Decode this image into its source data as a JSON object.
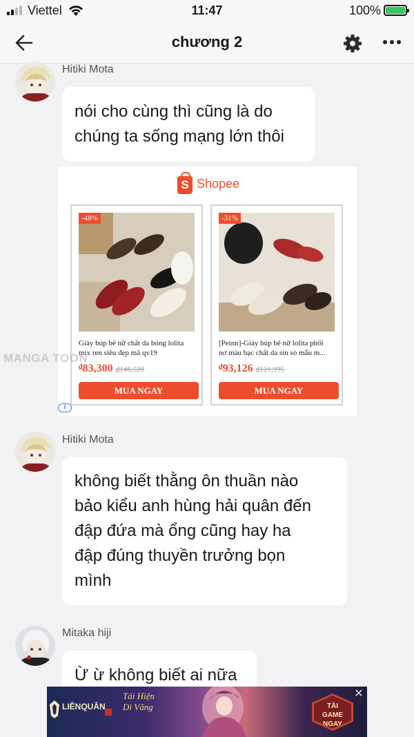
{
  "status_bar": {
    "carrier": "Viettel",
    "time": "11:47",
    "battery": "100%",
    "signal_bars_active": 2,
    "icons": [
      "signal-icon",
      "wifi-icon",
      "battery-charging-icon"
    ]
  },
  "nav": {
    "title": "chương 2",
    "icons": [
      "back-arrow-icon",
      "gear-icon",
      "more-icon"
    ]
  },
  "messages": [
    {
      "user": "Hitiki Mota",
      "lines": [
        "nói cho cùng thì cũng là do",
        "chúng ta sống mạng lớn thôi"
      ]
    },
    {
      "user": "Hitiki Mota",
      "lines": [
        "không biết thằng ôn thuần nào",
        "bảo kiểu anh hùng hải quân đến",
        "đập đứa mà ổng cũng hay ha",
        "đập đúng thuyền trưởng bọn",
        "mình"
      ]
    },
    {
      "user": "Mitaka hiji",
      "lines": [
        "Ừ ừ không biết ai nữa"
      ]
    }
  ],
  "ad": {
    "brand": "Shopee",
    "brand_glyph": "S",
    "currency": "₫",
    "info_glyph": "i",
    "products": [
      {
        "discount": "-48%",
        "name_lines": [
          "Giày búp bê nữ chất da bóng lolita",
          "mix ren siêu đẹp mã qv19"
        ],
        "price": "83,300",
        "old_price": "₫146,520",
        "button": "MUA NGAY"
      },
      {
        "discount": "-31%",
        "name_lines": [
          "[Peinn]-Giày búp bê nữ lolita phối",
          "nơ màu bạc chất da sin sò mẫu m..."
        ],
        "price": "93,126",
        "old_price": "₫121,995",
        "button": "MUA NGAY"
      }
    ]
  },
  "watermark": "MANGA TOON",
  "banner": {
    "logo": "LIÊNQUÂN",
    "slogan": "Tái Hiện Di Vãng",
    "cta_lines": [
      "TẢI",
      "GAME",
      "NGAY"
    ],
    "close": "✕"
  },
  "colors": {
    "shopee": "#ee4d2d",
    "background": "#f2f2f4",
    "bubble": "#ffffff",
    "battery": "#34c759"
  }
}
